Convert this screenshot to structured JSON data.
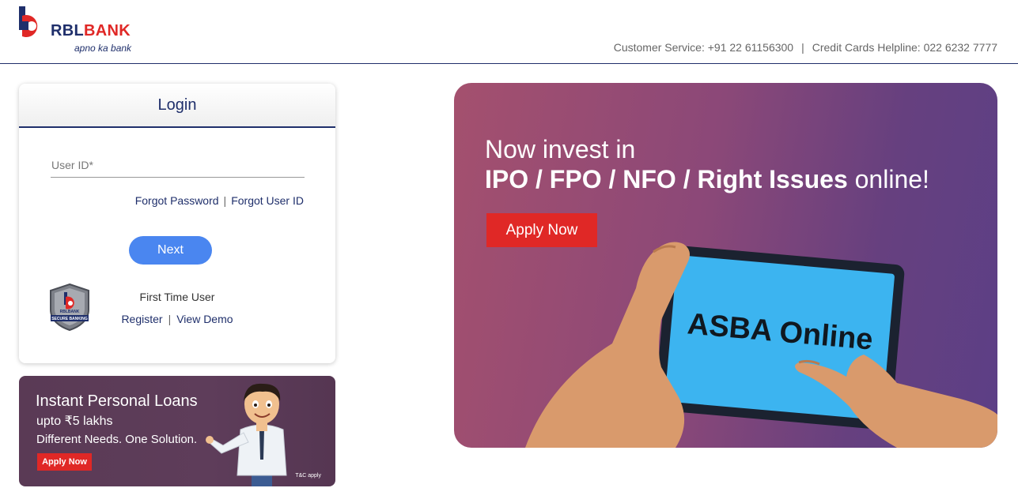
{
  "header": {
    "brand_primary": "RBL",
    "brand_secondary": "BANK",
    "tagline": "apno ka bank",
    "customer_service": "Customer Service: +91 22 61156300",
    "separator": "|",
    "cards_helpline": "Credit Cards Helpline: 022 6232 7777"
  },
  "login": {
    "title": "Login",
    "user_id_placeholder": "User ID*",
    "user_id_value": "",
    "forgot_password": "Forgot Password",
    "forgot_user_id": "Forgot User ID",
    "separator": "|",
    "next_label": "Next",
    "first_time_user": "First Time User",
    "register": "Register",
    "view_demo": "View Demo",
    "badge_text": "SECURE BANKING"
  },
  "loan_banner": {
    "title": "Instant Personal Loans",
    "amount": "upto ₹5 lakhs",
    "tagline": "Different Needs. One Solution.",
    "apply_label": "Apply Now",
    "tnc": "T&C apply"
  },
  "ipo_banner": {
    "line1": "Now invest in",
    "line2_bold": "IPO / FPO / NFO / Right Issues",
    "line2_rest": " online!",
    "apply_label": "Apply Now",
    "tablet_text": "ASBA Online"
  },
  "colors": {
    "brand_navy": "#1f2f6b",
    "brand_red": "#e02826",
    "primary_button": "#4a86f0"
  }
}
